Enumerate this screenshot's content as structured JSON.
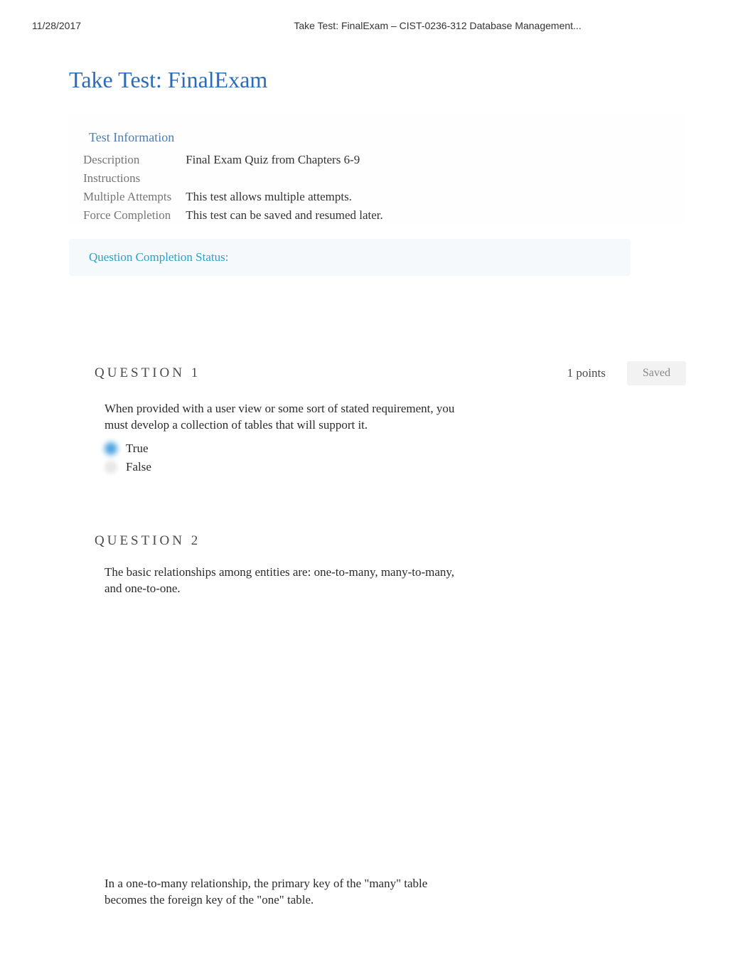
{
  "header": {
    "date": "11/28/2017",
    "title": "Take Test: FinalExam – CIST-0236-312 Database Management..."
  },
  "page_title": "Take Test: FinalExam",
  "info": {
    "heading": "Test Information",
    "rows": [
      {
        "label": "Description",
        "value": "Final Exam Quiz from Chapters 6-9"
      },
      {
        "label": "Instructions",
        "value": ""
      },
      {
        "label": "Multiple Attempts",
        "value": "This test allows multiple attempts."
      },
      {
        "label": "Force Completion",
        "value": "This test can be saved and resumed later."
      }
    ]
  },
  "status_label": "Question Completion Status:",
  "q1": {
    "title": "QUESTION 1",
    "points": "1 points",
    "saved": "Saved",
    "text": "When provided with a user view or some sort of stated requirement, you must develop a collection of tables that will support it.",
    "opt_true": "True",
    "opt_false": "False"
  },
  "q2": {
    "title": "QUESTION 2",
    "text": "The basic relationships among entities are: one-to-many, many-to-many, and one-to-one."
  },
  "q3": {
    "text": "In a one-to-many relationship, the primary key of the \"many\" table becomes the foreign key of the \"one\" table."
  }
}
